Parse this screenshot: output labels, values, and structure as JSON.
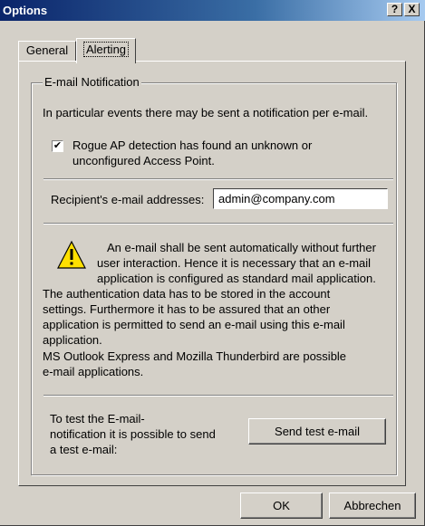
{
  "window": {
    "title": "Options",
    "help_glyph": "?",
    "close_glyph": "X"
  },
  "tabs": [
    {
      "label": "General"
    },
    {
      "label": "Alerting"
    }
  ],
  "group": {
    "legend": "E-mail Notification",
    "intro": "In particular events there may be sent a notification per e-mail.",
    "checkbox_checked": true,
    "checkbox_mark": "✔",
    "checkbox_label_line1": "Rogue AP detection has found an unknown or",
    "checkbox_label_line2": "unconfigured Access Point.",
    "recipient_label": "Recipient's e-mail addresses:",
    "recipient_value": "admin@company.com",
    "warning_icon": "warning-triangle-icon",
    "warning_lines": [
      "An e-mail shall be sent automatically without further",
      "user interaction. Hence it is necessary that an e-mail",
      "application is configured as standard mail application.",
      "The authentication data has to be stored in the account",
      "settings. Furthermore it has to be assured that an other",
      "application is permitted to send an e-mail using this e-mail",
      "application.",
      "MS Outlook Express and Mozilla Thunderbird are possible",
      "e-mail applications."
    ],
    "test_lines": [
      "To test the E-mail-",
      "notification it is possible to send",
      "a test e-mail:"
    ],
    "send_test_label": "Send test e-mail"
  },
  "footer": {
    "ok_label": "OK",
    "cancel_label": "Abbrechen"
  }
}
